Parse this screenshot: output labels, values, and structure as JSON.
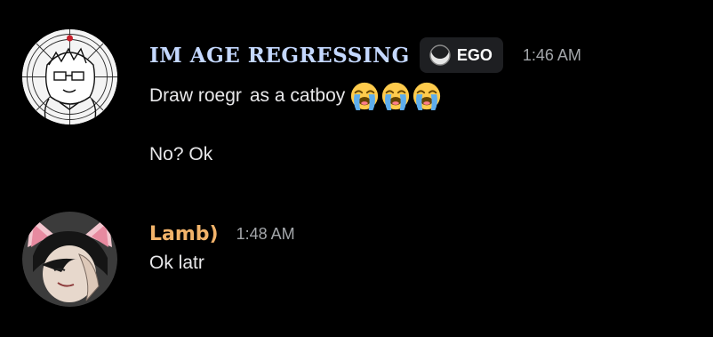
{
  "messages": [
    {
      "author": "IM AGE REGRESSING",
      "tag": {
        "label": "EGO",
        "icon": "moon-icon"
      },
      "time": "1:46 AM",
      "lines": [
        {
          "part1": "Draw roegr",
          "part2": "as a catboy",
          "emoji": [
            "loudly-crying-face-emoji",
            "loudly-crying-face-emoji",
            "loudly-crying-face-emoji"
          ]
        },
        {
          "text": "No? Ok"
        }
      ],
      "avatar": "spiderweb-sketch-avatar"
    },
    {
      "author": "Lamb)",
      "time": "1:48 AM",
      "lines": [
        {
          "text": "Ok latr"
        }
      ],
      "avatar": "cat-ear-portrait-avatar"
    }
  ],
  "colors": {
    "background": "#000000",
    "author1": "#c4d8ff",
    "author2": "#f2b36a",
    "timestamp": "#a3a6aa",
    "message_text": "#e8e8ea",
    "tag_background": "#1e1f22"
  }
}
